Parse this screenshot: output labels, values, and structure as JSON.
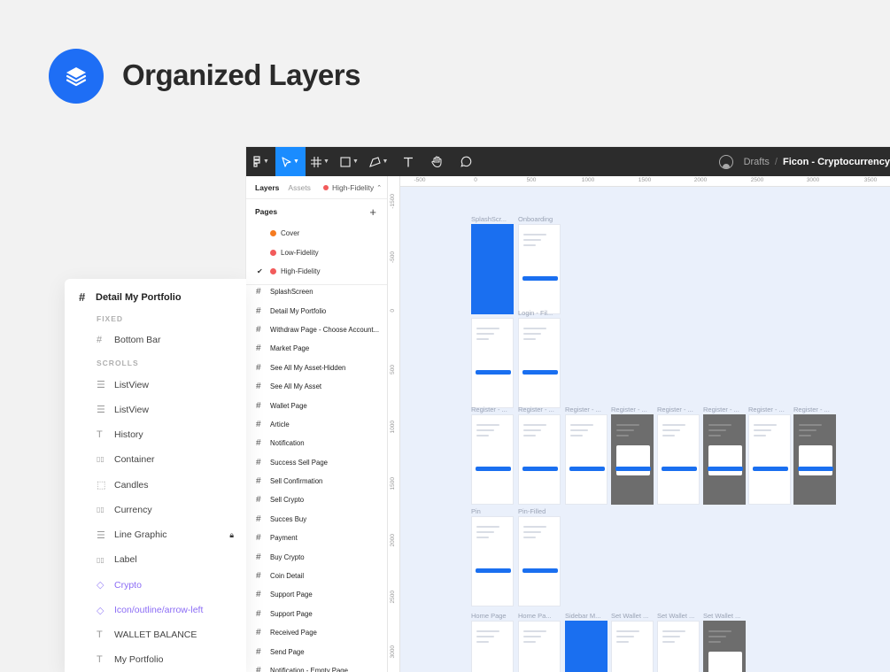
{
  "hero": {
    "title": "Organized Layers",
    "accent": "#1e6ef5",
    "icon": "layers-icon"
  },
  "toolbar": {
    "tools": [
      "figma-menu-icon",
      "move-icon",
      "frame-icon",
      "shape-icon",
      "pen-icon",
      "text-icon",
      "hand-icon",
      "comment-icon"
    ],
    "breadcrumb_location": "Drafts",
    "breadcrumb_separator": "/",
    "file_name": "Ficon - Cryptocurrency"
  },
  "panel": {
    "tab_layers": "Layers",
    "tab_assets": "Assets",
    "current_page": "High-Fidelity",
    "pages_title": "Pages",
    "pages": [
      {
        "label": "Cover",
        "color": "#f57b20",
        "checked": false
      },
      {
        "label": "Low-Fidelity",
        "color": "#f25b5b",
        "checked": false
      },
      {
        "label": "High-Fidelity",
        "color": "#f25b5b",
        "checked": true
      }
    ],
    "frames": [
      "SplashScreen",
      "Detail My Portfolio",
      "Withdraw Page - Choose Account...",
      "Market Page",
      "See All My Asset-Hidden",
      "See All My Asset",
      "Wallet Page",
      "Article",
      "Notification",
      "Success Sell Page",
      "Sell Confirmation",
      "Sell Crypto",
      "Succes Buy",
      "Payment",
      "Buy Crypto",
      "Coin Detail",
      "Support Page",
      "Support Page",
      "Received Page",
      "Send Page",
      "Notification - Empty Page"
    ]
  },
  "ruler": {
    "top": [
      "-500",
      "0",
      "500",
      "1000",
      "1500",
      "2000",
      "2500",
      "3000",
      "3500"
    ],
    "left": [
      "-1500",
      "-500",
      "0",
      "500",
      "1000",
      "1500",
      "2000",
      "2500",
      "3000"
    ]
  },
  "canvas": {
    "row1": [
      "SplashScr...",
      "Onboarding"
    ],
    "row2_label": "Login - Fil...",
    "row3": [
      "Register - ...",
      "Register - ...",
      "Register - ...",
      "Register - ...",
      "Register - ...",
      "Register - ...",
      "Register - ...",
      "Register - ..."
    ],
    "row4": [
      "Pin",
      "Pin-Filled"
    ],
    "row5": [
      "Home Page",
      "Home Pa...",
      "Sidebar M...",
      "Set Wallet ...",
      "Set Wallet ...",
      "Set Wallet ..."
    ]
  },
  "float": {
    "title": "Detail My Portfolio",
    "section_fixed": "FIXED",
    "section_scrolls": "SCROLLS",
    "fixed_items": [
      {
        "label": "Bottom Bar",
        "icon": "frame-hash-icon"
      }
    ],
    "scroll_items": [
      {
        "label": "ListView",
        "icon": "horizontal-layout-icon"
      },
      {
        "label": "ListView",
        "icon": "horizontal-layout-icon"
      },
      {
        "label": "History",
        "icon": "text-icon"
      },
      {
        "label": "Container",
        "icon": "vertical-layout-icon"
      },
      {
        "label": "Candles",
        "icon": "group-icon"
      },
      {
        "label": "Currency",
        "icon": "vertical-layout-icon"
      },
      {
        "label": "Line Graphic",
        "icon": "horizontal-layout-icon",
        "locked": true
      },
      {
        "label": "Label",
        "icon": "vertical-layout-icon"
      },
      {
        "label": "Crypto",
        "icon": "component-instance-icon",
        "component": true
      },
      {
        "label": "Icon/outline/arrow-left",
        "icon": "component-instance-icon",
        "component": true
      },
      {
        "label": "WALLET BALANCE",
        "icon": "text-icon"
      },
      {
        "label": "My Portfolio",
        "icon": "text-icon"
      }
    ]
  }
}
